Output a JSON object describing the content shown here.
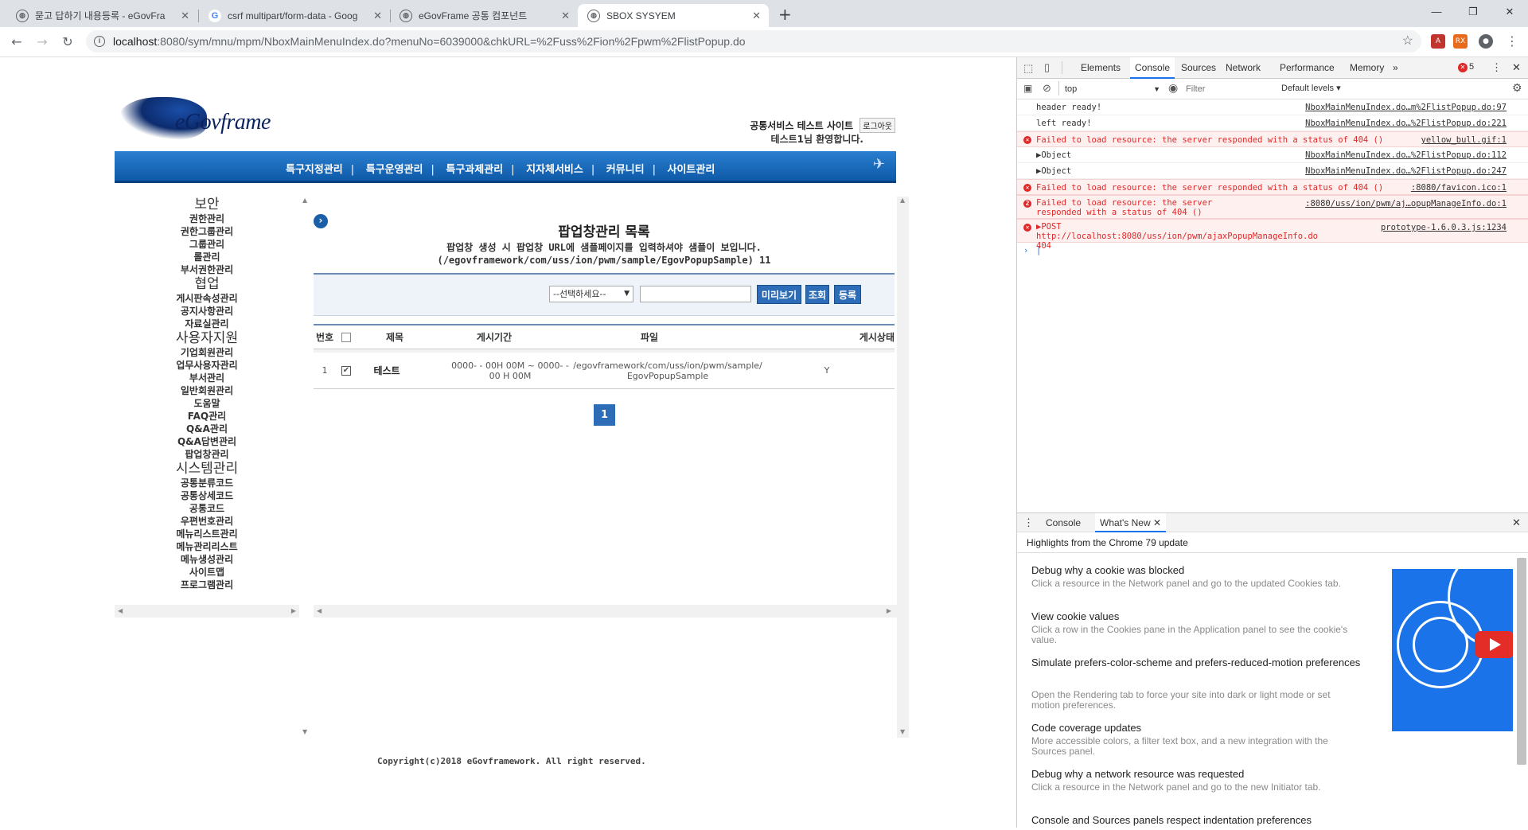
{
  "browser": {
    "tabs": [
      {
        "title": "묻고 답하기 내용등록 - eGovFra",
        "icon": "globe-icon"
      },
      {
        "title": "csrf multipart/form-data - Goog",
        "icon": "google-icon"
      },
      {
        "title": "eGovFrame 공통 컴포넌트",
        "icon": "globe-icon"
      },
      {
        "title": "SBOX SYSYEM",
        "icon": "globe-icon"
      }
    ],
    "url_host": "localhost",
    "url_rest": ":8080/sym/mnu/mpm/NboxMainMenuIndex.do?menuNo=6039000&chkURL=%2Fuss%2Fion%2Fpwm%2FlistPopup.do"
  },
  "site": {
    "logo_text": "eGovframe",
    "header_title": "공통서비스 테스트 사이트",
    "logout_label": "로그아웃",
    "welcome": "테스트1님 환영합니다.",
    "menu": [
      "특구지정관리",
      "특구운영관리",
      "특구과제관리",
      "지자체서비스",
      "커뮤니티",
      "사이트관리"
    ]
  },
  "sidenav": [
    {
      "type": "cat",
      "label": "보안"
    },
    {
      "type": "it",
      "label": "권한관리"
    },
    {
      "type": "it",
      "label": "권한그룹관리"
    },
    {
      "type": "it",
      "label": "그룹관리"
    },
    {
      "type": "it",
      "label": "롤관리"
    },
    {
      "type": "it",
      "label": "부서권한관리"
    },
    {
      "type": "cat",
      "label": "협업"
    },
    {
      "type": "it",
      "label": "게시판속성관리"
    },
    {
      "type": "it",
      "label": "공지사항관리"
    },
    {
      "type": "it",
      "label": "자료실관리"
    },
    {
      "type": "cat",
      "label": "사용자지원"
    },
    {
      "type": "it",
      "label": "기업회원관리"
    },
    {
      "type": "it",
      "label": "업무사용자관리"
    },
    {
      "type": "it",
      "label": "부서관리"
    },
    {
      "type": "it",
      "label": "일반회원관리"
    },
    {
      "type": "it",
      "label": "도움말"
    },
    {
      "type": "it",
      "label": "FAQ관리"
    },
    {
      "type": "it",
      "label": "Q&A관리"
    },
    {
      "type": "it",
      "label": "Q&A답변관리"
    },
    {
      "type": "it",
      "label": "팝업창관리"
    },
    {
      "type": "cat",
      "label": "시스템관리"
    },
    {
      "type": "it",
      "label": "공통분류코드"
    },
    {
      "type": "it",
      "label": "공통상세코드"
    },
    {
      "type": "it",
      "label": "공통코드"
    },
    {
      "type": "it",
      "label": "우편번호관리"
    },
    {
      "type": "it",
      "label": "메뉴리스트관리"
    },
    {
      "type": "it",
      "label": "메뉴관리리스트"
    },
    {
      "type": "it",
      "label": "메뉴생성관리"
    },
    {
      "type": "it",
      "label": "사이트맵"
    },
    {
      "type": "it",
      "label": "프로그램관리"
    }
  ],
  "content": {
    "title": "팝업창관리 목록",
    "desc1": "팝업창 생성 시 팝업창 URL에 샘플페이지를 입력하셔야 샘플이 보입니다.",
    "desc2": "(/egovframework/com/uss/ion/pwm/sample/EgovPopupSample) 11",
    "select_value": "--선택하세요--",
    "search_value": "",
    "btn_preview": "미리보기",
    "btn_search": "조회",
    "btn_register": "등록",
    "columns": {
      "no": "번호",
      "title": "제목",
      "period": "게시기간",
      "file": "파일",
      "status": "게시상태"
    },
    "rows": [
      {
        "no": "1",
        "checked": true,
        "title": "테스트",
        "period": "0000- - 00H 00M ~ 0000- - 00 H 00M",
        "file": "/egovframework/com/uss/ion/pwm/sample/EgovPopupSample",
        "status": "Y"
      }
    ],
    "page": "1",
    "footer": "Copyright(c)2018 eGovframework. All right reserved."
  },
  "devtools": {
    "tabs": [
      "Elements",
      "Console",
      "Sources",
      "Network",
      "Performance",
      "Memory"
    ],
    "more": "»",
    "error_count": "5",
    "context": "top",
    "filter_placeholder": "Filter",
    "levels": "Default levels ▾",
    "console": [
      {
        "type": "log",
        "text": "header ready!",
        "src": "NboxMainMenuIndex.do…m%2FlistPopup.do:97"
      },
      {
        "type": "log",
        "text": "left ready!",
        "src": "NboxMainMenuIndex.do…%2FlistPopup.do:221"
      },
      {
        "type": "err",
        "text": "Failed to load resource: the server responded with a status of 404 ()",
        "src": "yellow_bull.gif:1"
      },
      {
        "type": "obj",
        "text": "▶Object",
        "src": "NboxMainMenuIndex.do…%2FlistPopup.do:112"
      },
      {
        "type": "obj",
        "text": "▶Object",
        "src": "NboxMainMenuIndex.do…%2FlistPopup.do:247"
      },
      {
        "type": "err",
        "text": "Failed to load resource: the server responded with a status of 404 ()",
        "src": ":8080/favicon.ico:1"
      },
      {
        "type": "err2",
        "text": "Failed to load resource: the server responded with a status of 404 ()",
        "src": ":8080/uss/ion/pwm/aj…opupManageInfo.do:1",
        "badge": "2"
      },
      {
        "type": "err3",
        "text": "▶POST http://localhost:8080/uss/ion/pwm/ajaxPopupManageInfo.do 404",
        "src": "prototype-1.6.0.3.js:1234"
      }
    ],
    "drawer_tabs": [
      "Console",
      "What's New"
    ],
    "highlights": "Highlights from the Chrome 79 update",
    "news": [
      {
        "title": "Debug why a cookie was blocked",
        "desc": "Click a resource in the Network panel and go to the updated Cookies tab."
      },
      {
        "title": "View cookie values",
        "desc": "Click a row in the Cookies pane in the Application panel to see the cookie's value."
      },
      {
        "title": "Simulate prefers-color-scheme and prefers-reduced-motion preferences",
        "desc": "Open the Rendering tab to force your site into dark or light mode or set motion preferences."
      },
      {
        "title": "Code coverage updates",
        "desc": "More accessible colors, a filter text box, and a new integration with the Sources panel."
      },
      {
        "title": "Debug why a network resource was requested",
        "desc": "Click a resource in the Network panel and go to the new Initiator tab."
      },
      {
        "title": "Console and Sources panels respect indentation preferences",
        "desc": ""
      }
    ]
  }
}
